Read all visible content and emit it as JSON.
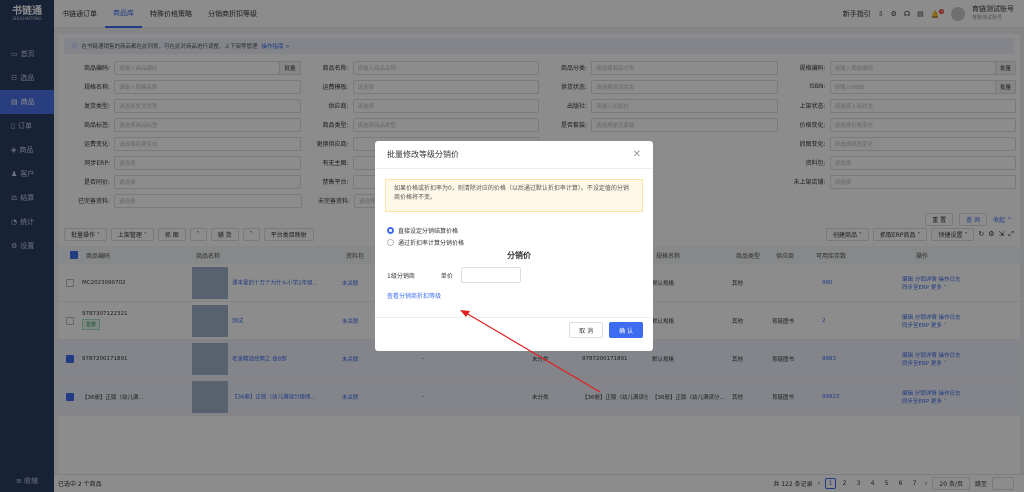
{
  "sidebar": {
    "logo": "书链通",
    "logo_sub": "SHULIANTONG",
    "items": [
      {
        "label": "首页"
      },
      {
        "label": "选品"
      },
      {
        "label": "商品"
      },
      {
        "label": "订单"
      },
      {
        "label": "商品"
      },
      {
        "label": "客户"
      },
      {
        "label": "结算"
      },
      {
        "label": "统计"
      },
      {
        "label": "设置"
      }
    ],
    "bottom": "≡ 收缩"
  },
  "topbar": {
    "tabs": [
      "书链通订单",
      "商品库",
      "特殊价格策略",
      "分销商折扣等级"
    ],
    "guide": "新手指引",
    "user_name": "育链测试账号",
    "user_sub": "育链测试账号",
    "badge": "9"
  },
  "notice": {
    "text": "在书链通销售的商品都在此列表，可在此对商品进行调整、上下架等管理",
    "link": "操作指南 >"
  },
  "filters": [
    [
      {
        "label": "商品编码:",
        "ph": "请输入商品编码",
        "btn": "批量"
      },
      {
        "label": "商品名称:",
        "ph": "请输入商品名称"
      },
      {
        "label": "商品分类:",
        "ph": "请选择商品分类"
      },
      {
        "label": "规格编码:",
        "ph": "请输入规格编码",
        "btn": "批量"
      }
    ],
    [
      {
        "label": "规格名称:",
        "ph": "请输入规格名称"
      },
      {
        "label": "运费模板:",
        "ph": "请选择"
      },
      {
        "label": "供货状态:",
        "ph": "请选择供货状态"
      },
      {
        "label": "ISBN:",
        "ph": "请输入ISBN",
        "btn": "批量"
      }
    ],
    [
      {
        "label": "发货类型:",
        "ph": "请选择发货类型"
      },
      {
        "label": "供应商:",
        "ph": "请选择"
      },
      {
        "label": "出版社:",
        "ph": "请输入出版社"
      },
      {
        "label": "上架状态:",
        "ph": "请选择上架状态"
      }
    ],
    [
      {
        "label": "商品标签:",
        "ph": "请选择商品标签"
      },
      {
        "label": "商品类型:",
        "ph": "请选择商品类型"
      },
      {
        "label": "是否套装:",
        "ph": "请选择是否套装"
      },
      {
        "label": "价格变化:",
        "ph": "请选择价格变化"
      }
    ],
    [
      {
        "label": "运费变化:",
        "ph": "请选择运费变化"
      },
      {
        "label": "更换供应商:",
        "ph": ""
      },
      {
        "label": "",
        "ph": ""
      },
      {
        "label": "抓图变化:",
        "ph": "请选择抓图变化"
      }
    ],
    [
      {
        "label": "同步ERP:",
        "ph": "请选择"
      },
      {
        "label": "有无主图:",
        "ph": ""
      },
      {
        "label": "",
        "ph": ""
      },
      {
        "label": "资料包:",
        "ph": "请选择"
      }
    ],
    [
      {
        "label": "是否同价:",
        "ph": "请选择"
      },
      {
        "label": "禁售平台:",
        "ph": ""
      },
      {
        "label": "",
        "ph": ""
      },
      {
        "label": "未上架店铺:",
        "ph": "请选择"
      }
    ],
    [
      {
        "label": "已完善资料:",
        "ph": "请选择"
      },
      {
        "label": "未完善资料:",
        "ph": "请选择"
      }
    ]
  ],
  "filter_actions": {
    "reset": "重 置",
    "search": "查 询",
    "collapse": "收起 ^"
  },
  "actions_left": [
    "批量操作 ˅",
    "上架管理 ˅",
    "抓 图",
    "˅",
    "辅 货",
    "˅",
    "平台类目映射"
  ],
  "actions_right": [
    "创建商品 ˅",
    "抓取ERP商品 ˅",
    "快捷设置 ˅"
  ],
  "table": {
    "headers": [
      "商品编码",
      "商品名称",
      "资料包",
      "",
      "",
      "",
      "规格名称",
      "商品类型",
      "供应商",
      "可用库存数",
      "",
      "操作"
    ],
    "rows": [
      {
        "code": "MC2023090702",
        "name": "课本里的十万个为什么小学2年级...",
        "pkg": "未关联",
        "cat": "",
        "spec": "默认规格",
        "type": "其他",
        "supplier": "",
        "stock": "980",
        "ops": "编辑  分销详情  操作日志",
        "ops2": "同步至ERP  更多 ˅",
        "selected": false,
        "tag": ""
      },
      {
        "code": "9787307122321",
        "name": "测试",
        "pkg": "未关联",
        "cat": "",
        "spec": "默认规格",
        "type": "其他",
        "supplier": "育链图书",
        "stock": "2",
        "ops": "编辑  分销详情  操作日志",
        "ops2": "同步至ERP  更多 ˅",
        "selected": false,
        "tag": "售罄"
      },
      {
        "code": "9787200171891",
        "name": "老舍精选经典之 金8部",
        "pkg": "未关联",
        "dash": "-",
        "dash2": "-",
        "cat": "未分类",
        "isbn": "9787200171891",
        "spec": "默认规格",
        "type": "其他",
        "supplier": "育链图书",
        "stock": "9983",
        "ops": "编辑  分销详情  操作日志",
        "ops2": "同步至ERP  更多 ˅",
        "selected": true,
        "tag": ""
      },
      {
        "code": "【36册】正版（幼儿满...",
        "name": "【36册】正版（幼儿满读分级阅...",
        "pkg": "未关联",
        "dash": "-",
        "dash2": "-",
        "cat": "未分类",
        "isbn": "【36册】正版（幼儿满读分级...",
        "spec": "【36册】正版（幼儿满读分...",
        "type": "其他",
        "supplier": "育链图书",
        "stock": "99923",
        "ops": "编辑  分销详情  操作日志",
        "ops2": "同步至ERP  更多 ˅",
        "selected": true,
        "tag": ""
      }
    ]
  },
  "footer": {
    "selected": "已选中 2 个商品",
    "total": "共 122 条记录",
    "pages": [
      "1",
      "2",
      "3",
      "4",
      "5",
      "6",
      "7"
    ],
    "per_page": "20 条/页",
    "jump": "跳至"
  },
  "modal": {
    "title": "批量修改等级分销价",
    "warning": "如果价格或折扣率为0，则清除对应的价格（以后通过默认折扣率计算）。不设定值的分销商价格将不变。",
    "opt1": "直接设定分销结算价格",
    "opt2": "通过折扣率计算分销价格",
    "section": "分销价",
    "level": "1级分销商",
    "unit": "单价",
    "link": "查看分销商折扣等级",
    "cancel": "取 消",
    "ok": "确 认"
  }
}
